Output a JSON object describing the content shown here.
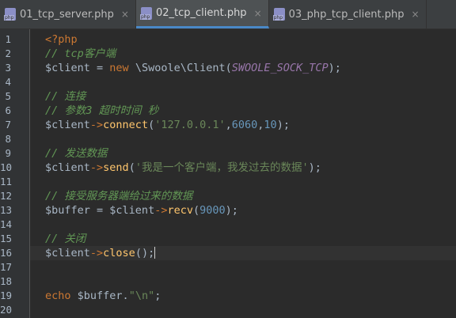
{
  "tabs": [
    {
      "label": "01_tcp_server.php",
      "close": "×",
      "active": false
    },
    {
      "label": "02_tcp_client.php",
      "close": "×",
      "active": true
    },
    {
      "label": "03_php_tcp_client.php",
      "close": "×",
      "active": false
    }
  ],
  "lines": [
    {
      "n": "1",
      "tokens": [
        [
          "php",
          "<?php"
        ]
      ]
    },
    {
      "n": "2",
      "tokens": [
        [
          "comment",
          "// tcp客户端"
        ]
      ]
    },
    {
      "n": "3",
      "tokens": [
        [
          "var",
          "$client"
        ],
        [
          "plain",
          " = "
        ],
        [
          "kw",
          "new "
        ],
        [
          "class",
          "\\Swoole\\Client"
        ],
        [
          "plain",
          "("
        ],
        [
          "const",
          "SWOOLE_SOCK_TCP"
        ],
        [
          "plain",
          ");"
        ]
      ]
    },
    {
      "n": "4",
      "tokens": []
    },
    {
      "n": "5",
      "tokens": [
        [
          "comment",
          "// 连接"
        ]
      ]
    },
    {
      "n": "6",
      "tokens": [
        [
          "comment",
          "// 参数3 超时时间 秒"
        ]
      ]
    },
    {
      "n": "7",
      "tokens": [
        [
          "var",
          "$client"
        ],
        [
          "op",
          "->"
        ],
        [
          "method",
          "connect"
        ],
        [
          "plain",
          "("
        ],
        [
          "str",
          "'127.0.0.1'"
        ],
        [
          "plain",
          ","
        ],
        [
          "num",
          "6060"
        ],
        [
          "plain",
          ","
        ],
        [
          "num",
          "10"
        ],
        [
          "plain",
          ");"
        ]
      ]
    },
    {
      "n": "8",
      "tokens": []
    },
    {
      "n": "9",
      "tokens": [
        [
          "comment",
          "// 发送数据"
        ]
      ]
    },
    {
      "n": "10",
      "tokens": [
        [
          "var",
          "$client"
        ],
        [
          "op",
          "->"
        ],
        [
          "method",
          "send"
        ],
        [
          "plain",
          "("
        ],
        [
          "str",
          "'我是一个客户端，我发过去的数据'"
        ],
        [
          "plain",
          ");"
        ]
      ]
    },
    {
      "n": "11",
      "tokens": []
    },
    {
      "n": "12",
      "tokens": [
        [
          "comment",
          "// 接受服务器端给过来的数据"
        ]
      ]
    },
    {
      "n": "13",
      "tokens": [
        [
          "var",
          "$buffer"
        ],
        [
          "plain",
          " = "
        ],
        [
          "var",
          "$client"
        ],
        [
          "op",
          "->"
        ],
        [
          "method",
          "recv"
        ],
        [
          "plain",
          "("
        ],
        [
          "num",
          "9000"
        ],
        [
          "plain",
          ");"
        ]
      ]
    },
    {
      "n": "14",
      "tokens": []
    },
    {
      "n": "15",
      "tokens": [
        [
          "comment",
          "// 关闭"
        ]
      ]
    },
    {
      "n": "16",
      "tokens": [
        [
          "var",
          "$client"
        ],
        [
          "op",
          "->"
        ],
        [
          "method",
          "close"
        ],
        [
          "plain",
          "();"
        ]
      ],
      "current": true
    },
    {
      "n": "17",
      "tokens": []
    },
    {
      "n": "18",
      "tokens": []
    },
    {
      "n": "19",
      "tokens": [
        [
          "kw",
          "echo "
        ],
        [
          "var",
          "$buffer"
        ],
        [
          "plain",
          "."
        ],
        [
          "str",
          "\"\\n\""
        ],
        [
          "plain",
          ";"
        ]
      ]
    },
    {
      "n": "20",
      "tokens": []
    }
  ]
}
